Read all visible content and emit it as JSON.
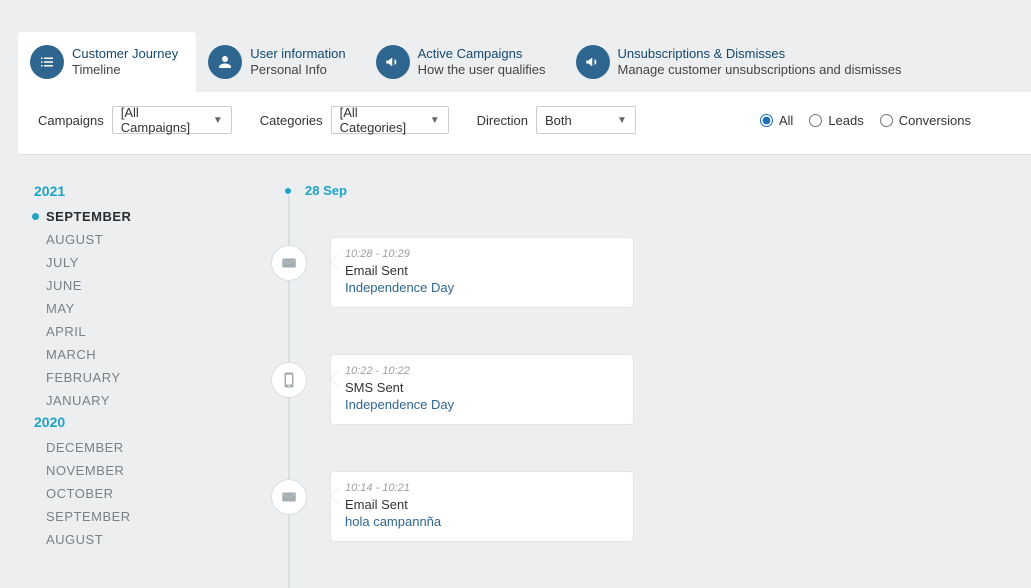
{
  "tabs": [
    {
      "title": "Customer Journey",
      "sub": "Timeline",
      "icon": "list"
    },
    {
      "title": "User information",
      "sub": "Personal Info",
      "icon": "user"
    },
    {
      "title": "Active Campaigns",
      "sub": "How the user qualifies",
      "icon": "megaphone"
    },
    {
      "title": "Unsubscriptions & Dismisses",
      "sub": "Manage customer unsubscriptions and dismisses",
      "icon": "megaphone"
    }
  ],
  "filters": {
    "campaigns_label": "Campaigns",
    "campaigns_value": "[All Campaigns]",
    "categories_label": "Categories",
    "categories_value": "[All Categories]",
    "direction_label": "Direction",
    "direction_value": "Both",
    "radio_all": "All",
    "radio_leads": "Leads",
    "radio_conversions": "Conversions",
    "radio_selected": "all"
  },
  "sidebar": {
    "groups": [
      {
        "year": "2021",
        "months": [
          "SEPTEMBER",
          "AUGUST",
          "JULY",
          "JUNE",
          "MAY",
          "APRIL",
          "MARCH",
          "FEBRUARY",
          "JANUARY"
        ],
        "active": "SEPTEMBER"
      },
      {
        "year": "2020",
        "months": [
          "DECEMBER",
          "NOVEMBER",
          "OCTOBER",
          "SEPTEMBER",
          "AUGUST"
        ],
        "active": null
      }
    ]
  },
  "timeline": {
    "date_label": "28 Sep",
    "events": [
      {
        "time": "10:28 - 10:29",
        "title": "Email Sent",
        "campaign": "Independence Day",
        "icon": "mail"
      },
      {
        "time": "10:22 - 10:22",
        "title": "SMS Sent",
        "campaign": "Independence Day",
        "icon": "phone"
      },
      {
        "time": "10:14 - 10:21",
        "title": "Email Sent",
        "campaign": "hola campannña",
        "icon": "mail"
      }
    ]
  }
}
